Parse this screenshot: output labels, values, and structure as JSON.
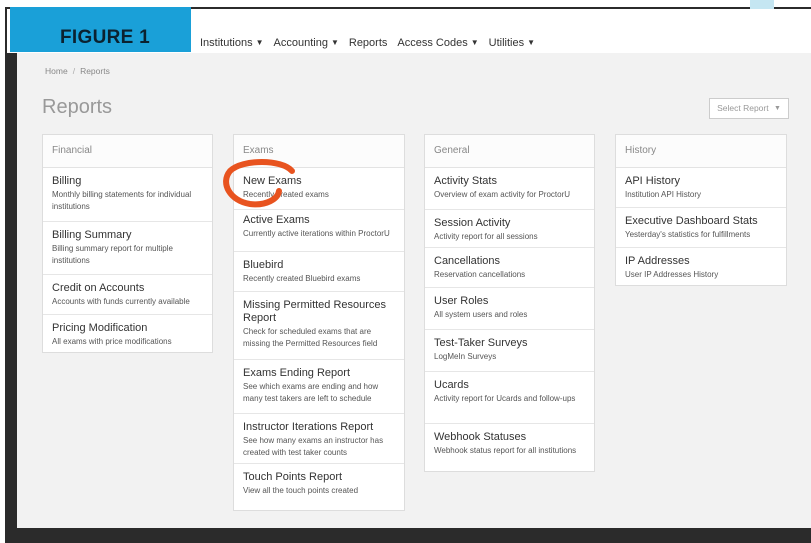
{
  "banner": {
    "label": "FIGURE 1"
  },
  "nav": {
    "items": [
      {
        "label": "Institutions",
        "dropdown": true
      },
      {
        "label": "Accounting",
        "dropdown": true
      },
      {
        "label": "Reports",
        "dropdown": false
      },
      {
        "label": "Access Codes",
        "dropdown": true
      },
      {
        "label": "Utilities",
        "dropdown": true
      }
    ]
  },
  "breadcrumb": {
    "home": "Home",
    "separator": "/",
    "current": "Reports"
  },
  "page": {
    "title": "Reports",
    "select_label": "Select Report"
  },
  "panels": [
    {
      "title": "Financial",
      "items": [
        {
          "title": "Billing",
          "desc": "Monthly billing statements for individual institutions"
        },
        {
          "title": "Billing Summary",
          "desc": "Billing summary report for multiple institutions"
        },
        {
          "title": "Credit on Accounts",
          "desc": "Accounts with funds currently available"
        },
        {
          "title": "Pricing Modification",
          "desc": "All exams with price modifications"
        }
      ]
    },
    {
      "title": "Exams",
      "items": [
        {
          "title": "New Exams",
          "desc": "Recently created exams"
        },
        {
          "title": "Active Exams",
          "desc": "Currently active iterations within ProctorU"
        },
        {
          "title": "Bluebird",
          "desc": "Recently created Bluebird exams"
        },
        {
          "title": "Missing Permitted Resources Report",
          "desc": "Check for scheduled exams that are missing the Permitted Resources field"
        },
        {
          "title": "Exams Ending Report",
          "desc": "See which exams are ending and how many test takers are left to schedule"
        },
        {
          "title": "Instructor Iterations Report",
          "desc": "See how many exams an instructor has created with test taker counts"
        },
        {
          "title": "Touch Points Report",
          "desc": "View all the touch points created"
        }
      ]
    },
    {
      "title": "General",
      "items": [
        {
          "title": "Activity Stats",
          "desc": "Overview of exam activity for ProctorU"
        },
        {
          "title": "Session Activity",
          "desc": "Activity report for all sessions"
        },
        {
          "title": "Cancellations",
          "desc": "Reservation cancellations"
        },
        {
          "title": "User Roles",
          "desc": "All system users and roles"
        },
        {
          "title": "Test-Taker Surveys",
          "desc": "LogMeIn Surveys"
        },
        {
          "title": "Ucards",
          "desc": "Activity report for Ucards and follow-ups"
        },
        {
          "title": "Webhook Statuses",
          "desc": "Webhook status report for all institutions"
        }
      ]
    },
    {
      "title": "History",
      "items": [
        {
          "title": "API History",
          "desc": "Institution API History"
        },
        {
          "title": "Executive Dashboard Stats",
          "desc": "Yesterday's statistics for fulfillments"
        },
        {
          "title": "IP Addresses",
          "desc": "User IP Addresses History"
        }
      ]
    }
  ],
  "colors": {
    "banner": "#1aa0d8",
    "frame": "#2b2b2b",
    "highlight_circle": "#e8531f"
  }
}
